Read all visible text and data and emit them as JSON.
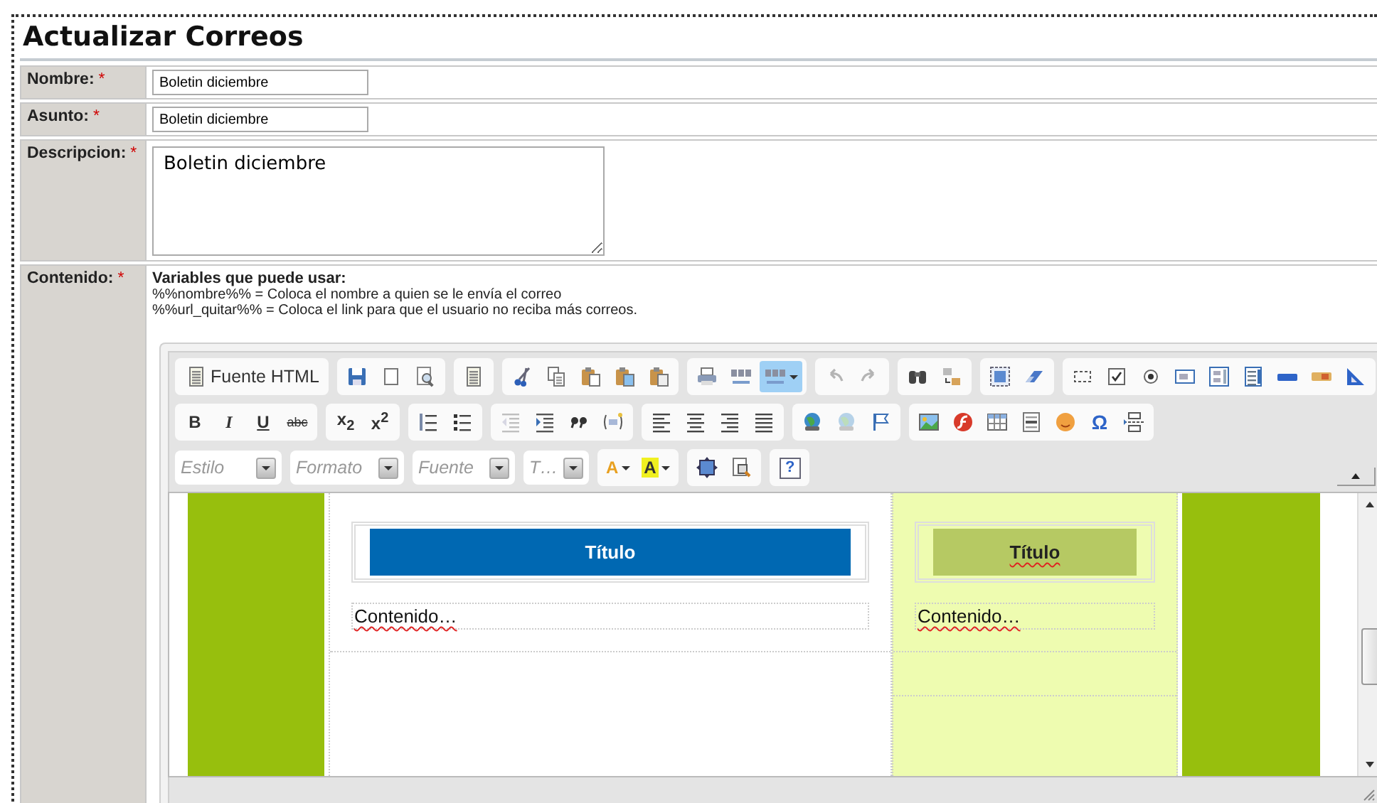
{
  "page_title": "Actualizar Correos",
  "fields": [
    {
      "kind": "input",
      "label": "Nombre:",
      "required_mark": "*",
      "value": "Boletin diciembre"
    },
    {
      "kind": "input",
      "label": "Asunto:",
      "required_mark": "*",
      "value": "Boletin diciembre"
    },
    {
      "kind": "textarea",
      "label": "Descripcion:",
      "required_mark": "*",
      "value": "Boletin diciembre"
    },
    {
      "kind": "editor",
      "label": "Contenido:",
      "required_mark": "*"
    }
  ],
  "variables": {
    "heading": "Variables que puede usar:",
    "lines": [
      "%%nombre%% = Coloca el nombre a quien se le envía el correo",
      "%%url_quitar%% = Coloca el link para que el usuario no reciba más correos."
    ]
  },
  "editor": {
    "toolbar": [
      [
        {
          "items": [
            {
              "kind": "text",
              "label": "Fuente HTML"
            }
          ]
        },
        {
          "items": [
            {
              "kind": "icon",
              "disabled": false
            },
            {
              "kind": "icon",
              "disabled": false
            },
            {
              "kind": "icon",
              "disabled": false
            }
          ]
        },
        {
          "items": [
            {
              "kind": "icon",
              "disabled": false
            }
          ]
        },
        {
          "items": [
            {
              "kind": "icon",
              "disabled": false
            },
            {
              "kind": "icon",
              "disabled": false
            },
            {
              "kind": "icon",
              "disabled": false
            },
            {
              "kind": "icon",
              "disabled": false
            },
            {
              "kind": "icon",
              "disabled": false
            }
          ]
        },
        {
          "items": [
            {
              "kind": "icon",
              "disabled": false
            },
            {
              "kind": "icon",
              "disabled": false
            },
            {
              "kind": "icon_menu",
              "disabled": false,
              "on": true
            }
          ]
        },
        {
          "items": [
            {
              "kind": "icon",
              "disabled": true
            },
            {
              "kind": "icon",
              "disabled": true
            }
          ]
        },
        {
          "items": [
            {
              "kind": "icon",
              "disabled": false
            },
            {
              "kind": "icon",
              "disabled": false
            }
          ]
        },
        {
          "items": [
            {
              "kind": "icon",
              "disabled": false
            },
            {
              "kind": "icon",
              "disabled": false
            }
          ]
        },
        {
          "items": [
            {
              "kind": "icon",
              "disabled": false
            },
            {
              "kind": "icon",
              "disabled": false
            },
            {
              "kind": "icon",
              "disabled": false
            },
            {
              "kind": "icon",
              "disabled": false
            },
            {
              "kind": "icon",
              "disabled": false
            },
            {
              "kind": "icon",
              "disabled": false
            },
            {
              "kind": "icon",
              "disabled": false
            },
            {
              "kind": "icon",
              "disabled": false
            },
            {
              "kind": "icon",
              "disabled": false
            }
          ]
        }
      ],
      [
        {
          "items": [
            {
              "kind": "bold",
              "label": "B",
              "disabled": false
            },
            {
              "kind": "italic",
              "label": "I",
              "disabled": false
            },
            {
              "kind": "underline",
              "label": "U",
              "disabled": false
            },
            {
              "kind": "strike",
              "label": "abc",
              "disabled": false
            }
          ]
        },
        {
          "items": [
            {
              "kind": "sub",
              "label": "x$_{2}$",
              "disabled": false
            },
            {
              "kind": "sup",
              "label": "x$^{2}$",
              "disabled": false
            }
          ]
        },
        {
          "items": [
            {
              "kind": "icon",
              "disabled": false
            },
            {
              "kind": "icon",
              "disabled": false
            }
          ]
        },
        {
          "items": [
            {
              "kind": "icon",
              "disabled": true
            },
            {
              "kind": "icon",
              "disabled": false
            },
            {
              "kind": "icon",
              "disabled": false
            },
            {
              "kind": "icon",
              "disabled": false
            }
          ]
        },
        {
          "items": [
            {
              "kind": "icon",
              "disabled": false
            },
            {
              "kind": "icon",
              "disabled": false
            },
            {
              "kind": "icon",
              "disabled": false
            },
            {
              "kind": "icon",
              "disabled": false
            }
          ]
        },
        {
          "items": [
            {
              "kind": "icon",
              "disabled": false
            },
            {
              "kind": "icon",
              "disabled": true
            },
            {
              "kind": "icon",
              "disabled": false
            }
          ]
        },
        {
          "items": [
            {
              "kind": "icon",
              "disabled": false
            },
            {
              "kind": "icon",
              "disabled": false
            },
            {
              "kind": "icon",
              "disabled": false
            },
            {
              "kind": "icon",
              "disabled": false
            },
            {
              "kind": "icon",
              "disabled": false
            },
            {
              "kind": "symbol",
              "label": "Ω",
              "disabled": false
            },
            {
              "kind": "icon",
              "disabled": false
            }
          ]
        }
      ],
      [
        {
          "items": [
            {
              "kind": "combo",
              "placeholder": "Estilo"
            }
          ]
        },
        {
          "items": [
            {
              "kind": "combo",
              "placeholder": "Formato"
            }
          ]
        },
        {
          "items": [
            {
              "kind": "combo",
              "placeholder": "Fuente"
            }
          ]
        },
        {
          "items": [
            {
              "kind": "combo",
              "placeholder": "T…"
            }
          ]
        },
        {
          "items": [
            {
              "kind": "color_text",
              "label": "A",
              "disabled": false
            },
            {
              "kind": "color_bg",
              "label": "A",
              "disabled": false
            }
          ]
        },
        {
          "items": [
            {
              "kind": "icon",
              "disabled": false
            },
            {
              "kind": "icon",
              "disabled": false
            }
          ]
        },
        {
          "items": [
            {
              "kind": "help",
              "label": "?",
              "disabled": false
            }
          ]
        }
      ]
    ],
    "columns": [
      {
        "kind": "main",
        "title": "Título",
        "title_misspelled": false,
        "body": "Contenido…",
        "body_misspelled": true
      },
      {
        "kind": "side",
        "title": "Título",
        "title_misspelled": true,
        "body": "Contenido…",
        "body_misspelled": true
      }
    ]
  }
}
